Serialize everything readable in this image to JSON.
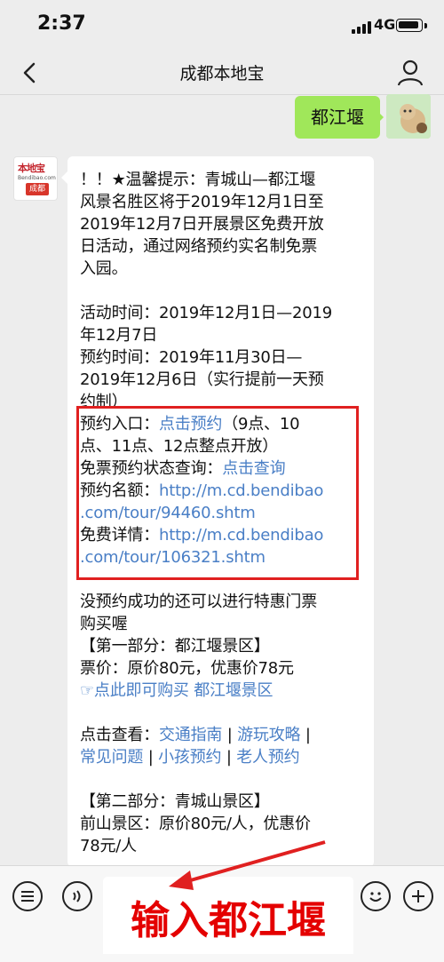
{
  "status": {
    "time": "2:37",
    "network": "4G"
  },
  "nav": {
    "title": "成都本地宝"
  },
  "chat": {
    "user_message": "都江堰",
    "bot_logo": {
      "top": "本地宝",
      "domain": "Bendibao.com",
      "city": "成都"
    },
    "lines": [
      "！！★温馨提示：青城山—都江堰",
      "风景名胜区将于2019年12月1日至",
      "2019年12月7日开展景区免费开放",
      "日活动，通过网络预约实名制免票",
      "入园。",
      "活动时间：2019年12月1日—2019",
      "年12月7日",
      "预约时间：2019年11月30日—",
      "2019年12月6日（实行提前一天预",
      "约制）",
      "预约入口：",
      "点击预约",
      "（9点、10",
      "点、11点、12点整点开放）",
      "免票预约状态查询：",
      "点击查询",
      "预约名额：",
      "http://m.cd.bendibao",
      ".com/tour/94460.shtm",
      "免费详情：",
      "http://m.cd.bendibao",
      ".com/tour/106321.shtm",
      "没预约成功的还可以进行特惠门票",
      "购买喔",
      "【第一部分：都江堰景区】",
      "票价：原价80元，优惠价78元",
      "☞点此即可购买 都江堰景区",
      "点击查看：",
      "交通指南",
      " | ",
      "游玩攻略",
      " | ",
      "常见问题",
      " | ",
      "小孩预约",
      " | ",
      "老人预约",
      "【第二部分：青城山景区】",
      "前山景区：原价80元/人，优惠价",
      "78元/人"
    ]
  },
  "overlay": {
    "caption": "输入都江堰"
  },
  "colors": {
    "link": "#4a7fc6",
    "bubble_user": "#a0e75a",
    "highlight": "#e02020"
  }
}
